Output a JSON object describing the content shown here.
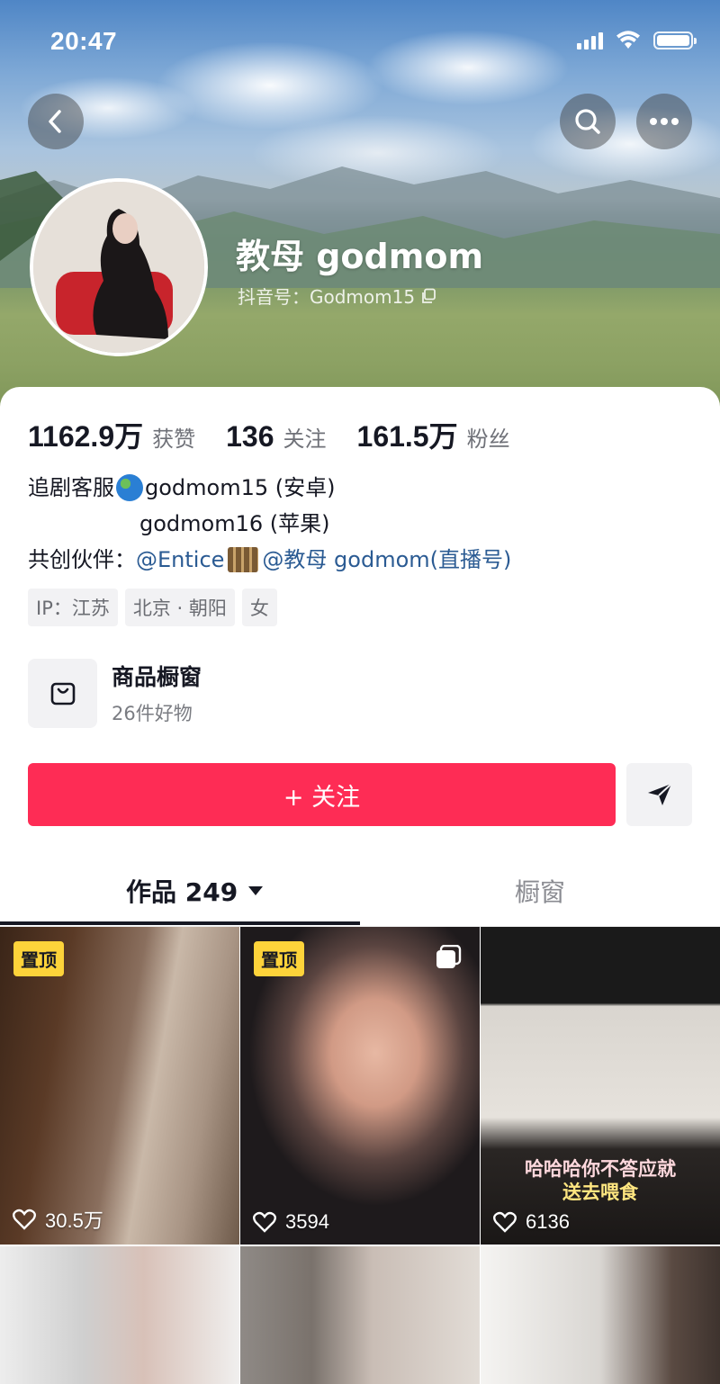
{
  "status_bar": {
    "time": "20:47",
    "icons": [
      "signal-icon",
      "wifi-icon",
      "battery-icon"
    ]
  },
  "header": {
    "nickname": "教母 godmom",
    "douyin_id": "抖音号：Godmom15"
  },
  "stats": [
    {
      "value": "1162.9万",
      "label": "获赞"
    },
    {
      "value": "136",
      "label": "关注"
    },
    {
      "value": "161.5万",
      "label": "粉丝"
    }
  ],
  "bio": {
    "line1_prefix": "追剧客服",
    "line1_account": "godmom15 (安卓)",
    "line2": "godmom16 (苹果)",
    "line3_prefix": "共创伙伴：",
    "line3_link1": "@Entice",
    "line3_link2": "@教母 godmom(直播号)"
  },
  "tags": [
    "IP：江苏",
    "北京 · 朝阳",
    "女"
  ],
  "shop": {
    "title": "商品橱窗",
    "subtitle": "26件好物"
  },
  "actions": {
    "follow_label": "+ 关注"
  },
  "tabs": {
    "works": "作品 249",
    "shop": "橱窗"
  },
  "videos": [
    {
      "pinned": "置顶",
      "likes": "30.5万"
    },
    {
      "pinned": "置顶",
      "likes": "3594"
    },
    {
      "likes": "6136",
      "caption_line1": "哈哈哈你不答应就",
      "caption_line2": "送去喂食"
    },
    {},
    {},
    {}
  ],
  "colors": {
    "accent": "#fe2c55",
    "pin_badge": "#fdd33a",
    "link": "#2b5b93"
  }
}
